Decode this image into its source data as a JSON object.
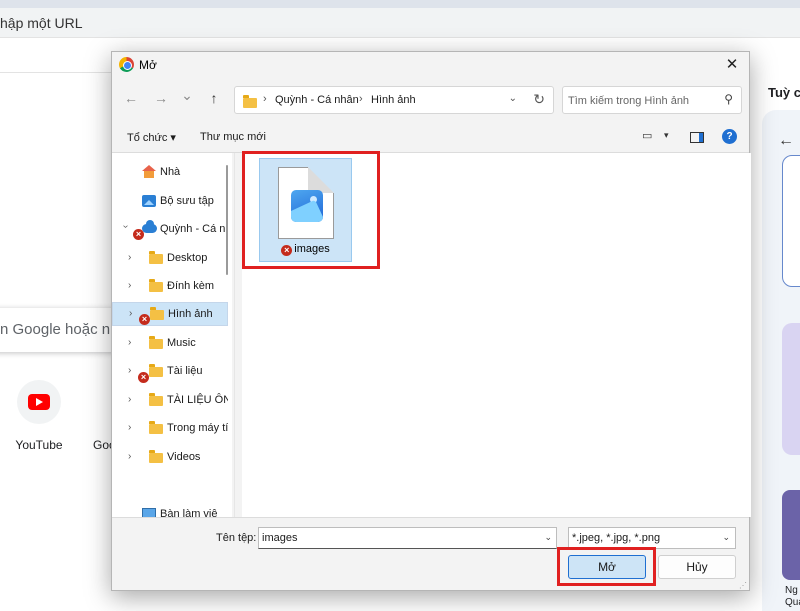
{
  "browser": {
    "address_placeholder": "hập một URL",
    "search_placeholder": "n Google hoặc nhập",
    "shortcuts": [
      {
        "label": "YouTube",
        "icon": "youtube-icon"
      },
      {
        "label": "Goo",
        "icon": "google-icon"
      }
    ],
    "side_panel_title": "Tuỳ ch",
    "side_panel_card_label_1": "Ng",
    "side_panel_card_label_2": "Quả"
  },
  "dialog": {
    "title": "Mở",
    "app_icon": "chrome-icon",
    "close_glyph": "✕",
    "nav": {
      "back_glyph": "←",
      "forward_glyph": "→",
      "recent_glyph": "⌄",
      "up_glyph": "↑"
    },
    "path": {
      "crumbs": [
        "Quỳnh - Cá nhân",
        "Hình ảnh"
      ],
      "separator": "›",
      "dropdown_glyph": "⌄",
      "refresh_glyph": "↻"
    },
    "search": {
      "placeholder": "Tìm kiếm trong Hình ảnh",
      "icon_glyph": "⚲"
    },
    "toolbar": {
      "organize_label": "Tổ chức ▾",
      "new_folder_label": "Thư mục mới",
      "help_glyph": "?"
    },
    "sidebar": {
      "items": [
        {
          "label": "Nhà",
          "icon": "home-icon"
        },
        {
          "label": "Bộ sưu tập",
          "icon": "gallery-icon"
        },
        {
          "label": "Quỳnh - Cá nhân",
          "icon": "onedrive-icon",
          "status": "error"
        },
        {
          "label": "Desktop",
          "icon": "folder-icon"
        },
        {
          "label": "Đính kèm",
          "icon": "folder-icon"
        },
        {
          "label": "Hình ảnh",
          "icon": "folder-icon",
          "status": "error",
          "selected": true
        },
        {
          "label": "Music",
          "icon": "folder-icon"
        },
        {
          "label": "Tài liệu",
          "icon": "folder-icon",
          "status": "error"
        },
        {
          "label": "TÀI LIỆU ÔN",
          "icon": "folder-icon"
        },
        {
          "label": "Trong máy tí",
          "icon": "folder-icon"
        },
        {
          "label": "Videos",
          "icon": "folder-icon"
        },
        {
          "label": "Bàn làm việ",
          "icon": "desktop-icon"
        }
      ],
      "chevron_glyph": "›",
      "error_glyph": "×"
    },
    "files": [
      {
        "name": "images",
        "icon": "image-file-icon",
        "status": "error"
      }
    ],
    "bottom": {
      "file_name_label": "Tên tệp:",
      "file_name_value": "images",
      "file_type_value": "*.jpeg, *.jpg, *.png",
      "open_label": "Mở",
      "cancel_label": "Hủy"
    }
  },
  "colors": {
    "highlight": "#e02020",
    "accent": "#1f6fd1",
    "selection": "#cce4f7",
    "error": "#c42b1c"
  }
}
